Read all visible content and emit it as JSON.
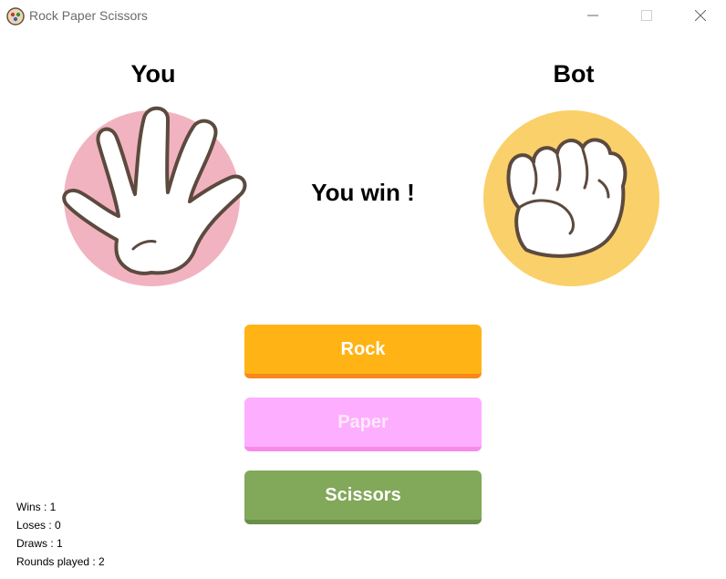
{
  "window": {
    "title": "Rock Paper Scissors",
    "controls": [
      "minimize-icon",
      "maximize-icon",
      "close-icon"
    ]
  },
  "players": {
    "you_label": "You",
    "bot_label": "Bot",
    "you_choice_icon": "open-hand-paper-icon",
    "bot_choice_icon": "fist-rock-icon"
  },
  "result": "You win !",
  "buttons": {
    "rock": "Rock",
    "paper": "Paper",
    "scissors": "Scissors"
  },
  "stats": {
    "wins": "Wins : 1",
    "loses": "Loses : 0",
    "draws": "Draws : 1",
    "rounds": "Rounds played : 2"
  },
  "colors": {
    "you_circle": "#f2b3c0",
    "bot_circle": "#fad06a",
    "rock_button": "#ffb314",
    "paper_button": "#feaeff",
    "scissors_button": "#82a85a"
  }
}
